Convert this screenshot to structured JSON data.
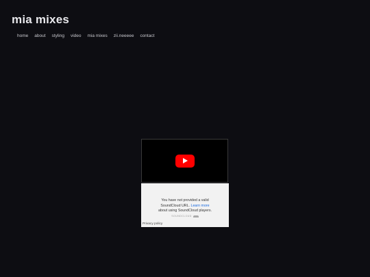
{
  "site": {
    "title": "mia mixes"
  },
  "nav": {
    "items": [
      {
        "label": "home"
      },
      {
        "label": "about"
      },
      {
        "label": "styling"
      },
      {
        "label": "video"
      },
      {
        "label": "mia mixes"
      },
      {
        "label": "zii.neeeee"
      },
      {
        "label": "contact"
      }
    ]
  },
  "video": {
    "icon": "youtube-play-icon",
    "accent": "#ff0000"
  },
  "soundcloud": {
    "line1": "You have not provided a valid",
    "line2_prefix": "SoundCloud URL. ",
    "learn_more": "Learn more",
    "line3": "about using SoundCloud players.",
    "brand": "SOUNDCLOUD",
    "privacy": "Privacy policy",
    "link_color": "#1a6be0"
  }
}
